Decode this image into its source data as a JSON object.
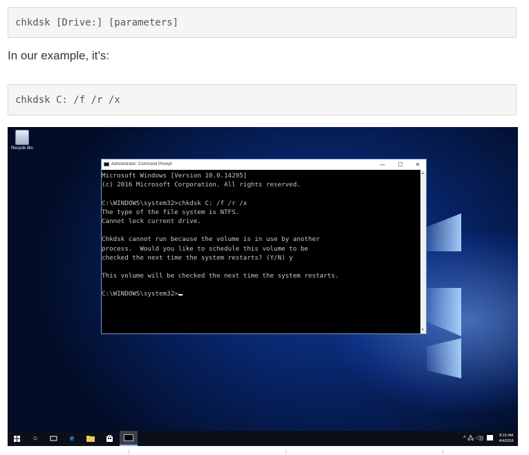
{
  "code_block_1": "chkdsk [Drive:] [parameters]",
  "paragraph": "In our example, it’s:",
  "code_block_2": "chkdsk C: /f /r /x",
  "desktop": {
    "recycle_bin_label": "Recycle Bin",
    "cmd_window": {
      "title": "Administrator: Command Prompt",
      "minimize": "—",
      "maximize": "☐",
      "close": "✕",
      "lines": [
        "Microsoft Windows [Version 10.0.14295]",
        "(c) 2016 Microsoft Corporation. All rights reserved.",
        "",
        "C:\\WINDOWS\\system32>chkdsk C: /f /r /x",
        "The type of the file system is NTFS.",
        "Cannot lock current drive.",
        "",
        "Chkdsk cannot run because the volume is in use by another",
        "process.  Would you like to schedule this volume to be",
        "checked the next time the system restarts? (Y/N) y",
        "",
        "This volume will be checked the next time the system restarts.",
        "",
        "C:\\WINDOWS\\system32>"
      ]
    },
    "taskbar": {
      "start_icon": "windows-logo-icon",
      "search_glyph": "○",
      "edge_glyph": "e",
      "tray_glyphs": "^ 🖧 ◁))",
      "time": "8:15 AM",
      "date": "4/4/2016"
    }
  }
}
